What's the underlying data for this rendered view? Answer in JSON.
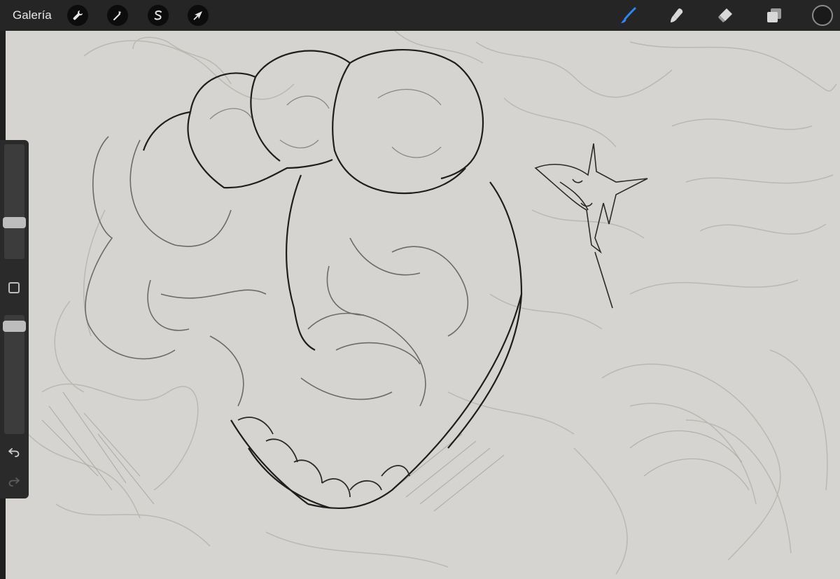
{
  "app": {
    "gallery_label": "Galería"
  },
  "toolbar": {
    "left_tools": [
      {
        "name": "actions",
        "icon": "wrench-icon"
      },
      {
        "name": "adjustments",
        "icon": "magic-wand-icon"
      },
      {
        "name": "selection",
        "icon": "selection-s-icon"
      },
      {
        "name": "transform",
        "icon": "arrow-cursor-icon"
      }
    ],
    "right_tools": [
      {
        "name": "brush",
        "icon": "brush-icon",
        "active": true,
        "color": "#2f86f6"
      },
      {
        "name": "smudge",
        "icon": "smudge-icon",
        "active": false
      },
      {
        "name": "eraser",
        "icon": "eraser-icon",
        "active": false
      },
      {
        "name": "layers",
        "icon": "layers-icon",
        "active": false
      }
    ],
    "current_color": "#1a1a1a"
  },
  "sidebar": {
    "brush_size_level": 0.3,
    "opacity_level": 0.95,
    "undo_icon": "undo-icon",
    "redo_icon": "redo-icon"
  },
  "canvas": {
    "background": "#d6d4d0"
  }
}
